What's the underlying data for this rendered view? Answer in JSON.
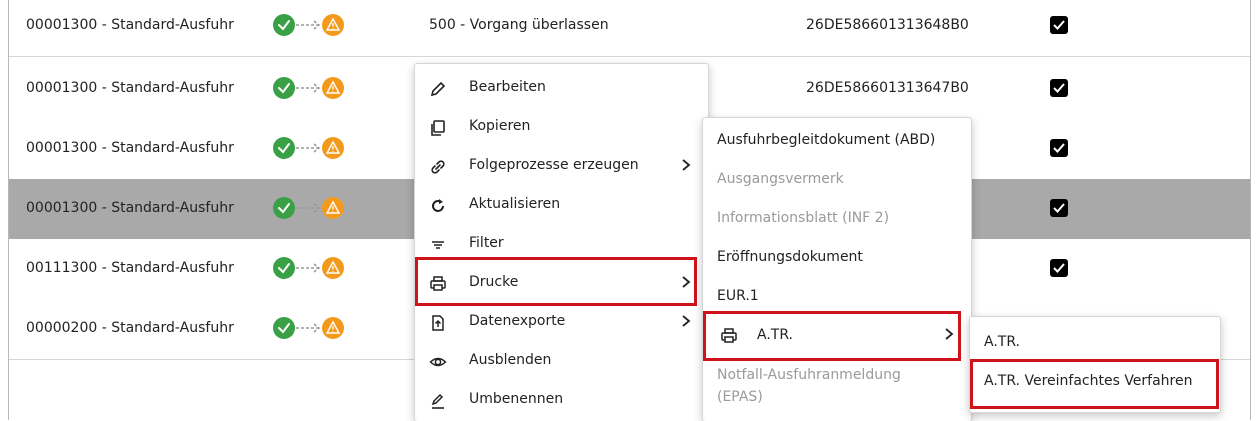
{
  "rows": [
    {
      "name": "00001300 - Standard-Ausfuhr",
      "desc": "500 - Vorgang überlassen",
      "id": "26DE586601313648B0",
      "checked": true
    },
    {
      "name": "00001300 - Standard-Ausfuhr",
      "desc": "",
      "id": "26DE586601313647B0",
      "checked": true
    },
    {
      "name": "00001300 - Standard-Ausfuhr",
      "desc": "",
      "id": "",
      "checked": true
    },
    {
      "name": "00001300 - Standard-Ausfuhr",
      "desc": "",
      "id": "",
      "checked": true
    },
    {
      "name": "00111300 - Standard-Ausfuhr",
      "desc": "",
      "id": "",
      "checked": true
    },
    {
      "name": "00000200 - Standard-Ausfuhr",
      "desc": "",
      "id": "",
      "checked": false
    }
  ],
  "context_menu": {
    "items": [
      {
        "label": "Bearbeiten",
        "icon": "pencil-icon"
      },
      {
        "label": "Kopieren",
        "icon": "copy-icon"
      },
      {
        "label": "Folgeprozesse erzeugen",
        "icon": "link-icon"
      },
      {
        "label": "Aktualisieren",
        "icon": "refresh-icon"
      },
      {
        "label": "Filter",
        "icon": "filter-icon"
      },
      {
        "label": "Drucke",
        "icon": "printer-icon"
      },
      {
        "label": "Datenexporte",
        "icon": "export-icon"
      },
      {
        "label": "Ausblenden",
        "icon": "eye-icon"
      },
      {
        "label": "Umbenennen",
        "icon": "rename-icon"
      }
    ]
  },
  "print_menu": {
    "items": [
      {
        "label": "Ausfuhrbegleitdokument (ABD)",
        "disabled": false
      },
      {
        "label": "Ausgangsvermerk",
        "disabled": true
      },
      {
        "label": "Informationsblatt (INF 2)",
        "disabled": true
      },
      {
        "label": "Eröffnungsdokument",
        "disabled": false
      },
      {
        "label": "EUR.1",
        "disabled": false
      },
      {
        "label": "A.TR.",
        "disabled": false
      },
      {
        "label": "Notfall-Ausfuhranmeldung",
        "label2": "(EPAS)",
        "disabled": true
      }
    ]
  },
  "atr_menu": {
    "items": [
      {
        "label": "A.TR."
      },
      {
        "label": "A.TR. Vereinfachtes Verfahren"
      }
    ]
  },
  "colors": {
    "success": "#3aa046",
    "warning": "#f39a1c",
    "highlight": "#d0121b",
    "selected_row": "#a9a9a9"
  }
}
